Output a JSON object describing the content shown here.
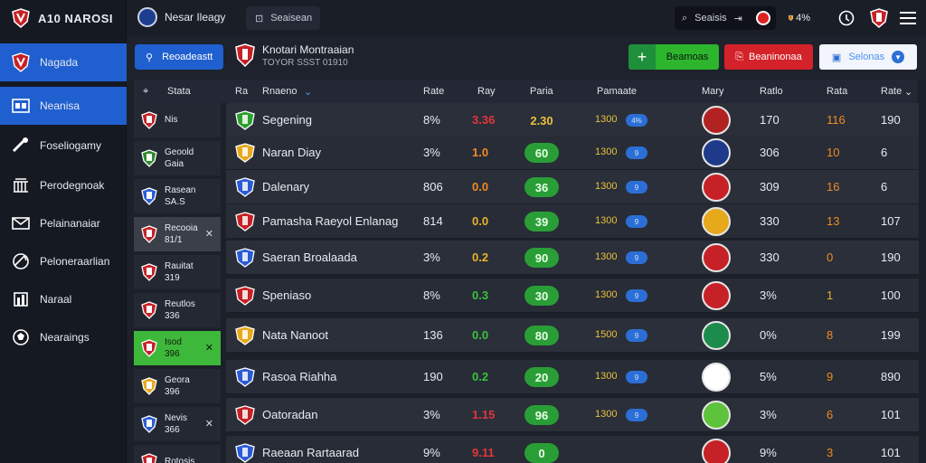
{
  "app": {
    "logo_text": "A10 NAROSI"
  },
  "sidebar": {
    "items": [
      {
        "label": "Nagada",
        "icon": "team-badge-icon",
        "active": true
      },
      {
        "label": "Neanisa",
        "icon": "scoreboard-icon",
        "active": true
      },
      {
        "label": "Foseliogamy",
        "icon": "whistle-icon",
        "active": false
      },
      {
        "label": "Perodegnoak",
        "icon": "stadium-icon",
        "active": false
      },
      {
        "label": "Pelainanaiar",
        "icon": "mail-icon",
        "active": false
      },
      {
        "label": "Peloneraarlian",
        "icon": "globe-icon",
        "active": false
      },
      {
        "label": "Naraal",
        "icon": "chart-icon",
        "active": false
      },
      {
        "label": "Nearaings",
        "icon": "soccer-ball-icon",
        "active": false
      }
    ]
  },
  "topbar": {
    "brand": "Nesar Ileagy",
    "search_label": "Seaisean",
    "top_search": "Seaisis",
    "icons": [
      "team-flag-icon",
      "info-icon",
      "shield-icon",
      "menu-icon"
    ],
    "flag_text": "4%"
  },
  "actionbar": {
    "primary_label": "Reoadeastt",
    "match_title": "Knotari Montraaian",
    "match_subtitle": "TOYOR SSST 01910",
    "green_label": "Beamoas",
    "red_label": "Beaninonaa",
    "white_label": "Selonas"
  },
  "thead": {
    "list_title": "Stata",
    "col_team_prefix": "Ra",
    "col_team": "Rnaeno",
    "col_rate": "Rate",
    "col_ray": "Ray",
    "col_paria": "Paria",
    "col_pamaate": "Pamaate",
    "col_mary": "Mary",
    "col_ratio": "Ratlo",
    "col_rata": "Rata",
    "col_rate2": "Rate"
  },
  "match_list": [
    {
      "l1": "Nis",
      "l2": "",
      "state": "normal",
      "close": false
    },
    {
      "l1": "Geoold",
      "l2": "Gaia",
      "state": "normal",
      "close": false
    },
    {
      "l1": "Rasean",
      "l2": "SA.S",
      "state": "normal",
      "close": false
    },
    {
      "l1": "Recooia",
      "l2": "81/1",
      "state": "selected",
      "close": true
    },
    {
      "l1": "Rauitat",
      "l2": "319",
      "state": "normal",
      "close": false
    },
    {
      "l1": "Reutlos",
      "l2": "336",
      "state": "normal",
      "close": false
    },
    {
      "l1": "Isod",
      "l2": "396",
      "state": "green",
      "close": true
    },
    {
      "l1": "Geora",
      "l2": "396",
      "state": "normal",
      "close": false
    },
    {
      "l1": "Nevis",
      "l2": "366",
      "state": "normal",
      "close": true
    },
    {
      "l1": "Rotosis",
      "l2": "",
      "state": "normal",
      "close": false
    }
  ],
  "rows": [
    {
      "team": "Segening",
      "rate": "8%",
      "ray": "3.36",
      "ray_color": "red",
      "pill": "2.30",
      "pill_style": "gold",
      "pct": "1300",
      "mini": "4%",
      "ratio": "170",
      "rata": "116",
      "rata_color": "orange",
      "rate3": "190"
    },
    {
      "team": "Naran Diay",
      "rate": "3%",
      "ray": "1.0",
      "ray_color": "orange",
      "pill": "60",
      "pill_style": "green",
      "pct": "1300",
      "mini": "9",
      "ratio": "306",
      "rata": "10",
      "rata_color": "orange",
      "rate3": "6"
    },
    {
      "team": "Dalenary",
      "rate": "806",
      "ray": "0.0",
      "ray_color": "orange",
      "pill": "36",
      "pill_style": "green",
      "pct": "1300",
      "mini": "9",
      "ratio": "309",
      "rata": "16",
      "rata_color": "orange",
      "rate3": "6"
    },
    {
      "team": "Pamasha Raeyol Enlanag",
      "rate": "814",
      "ray": "0.0",
      "ray_color": "yellow",
      "pill": "39",
      "pill_style": "green",
      "pct": "1300",
      "mini": "9",
      "ratio": "330",
      "rata": "13",
      "rata_color": "orange",
      "rate3": "107"
    },
    {
      "team": "Saeran Broalaada",
      "rate": "3%",
      "ray": "0.2",
      "ray_color": "yellow",
      "pill": "90",
      "pill_style": "green",
      "pct": "1300",
      "mini": "9",
      "ratio": "330",
      "rata": "0",
      "rata_color": "orange",
      "rate3": "190"
    },
    {
      "team": "Speniaso",
      "rate": "8%",
      "ray": "0.3",
      "ray_color": "green",
      "pill": "30",
      "pill_style": "green",
      "pct": "1300",
      "mini": "9",
      "ratio": "3%",
      "rata": "1",
      "rata_color": "yellow",
      "rate3": "100"
    },
    {
      "team": "Nata Nanoot",
      "rate": "136",
      "ray": "0.0",
      "ray_color": "green",
      "pill": "80",
      "pill_style": "green",
      "pct": "1500",
      "mini": "9",
      "ratio": "0%",
      "rata": "8",
      "rata_color": "orange",
      "rate3": "199"
    },
    {
      "team": "Rasoa Riahha",
      "rate": "190",
      "ray": "0.2",
      "ray_color": "green",
      "pill": "20",
      "pill_style": "green",
      "pct": "1300",
      "mini": "9",
      "ratio": "5%",
      "rata": "9",
      "rata_color": "orange",
      "rate3": "890"
    },
    {
      "team": "Oatoradan",
      "rate": "3%",
      "ray": "1.15",
      "ray_color": "red",
      "pill": "96",
      "pill_style": "green",
      "pct": "1300",
      "mini": "9",
      "ratio": "3%",
      "rata": "6",
      "rata_color": "orange",
      "rate3": "101"
    },
    {
      "team": "Raeaan Rartaarad",
      "rate": "9%",
      "ray": "9.11",
      "ray_color": "red",
      "pill": "0",
      "pill_style": "green",
      "pct": "",
      "mini": "",
      "ratio": "9%",
      "rata": "3",
      "rata_color": "orange",
      "rate3": "101"
    }
  ]
}
